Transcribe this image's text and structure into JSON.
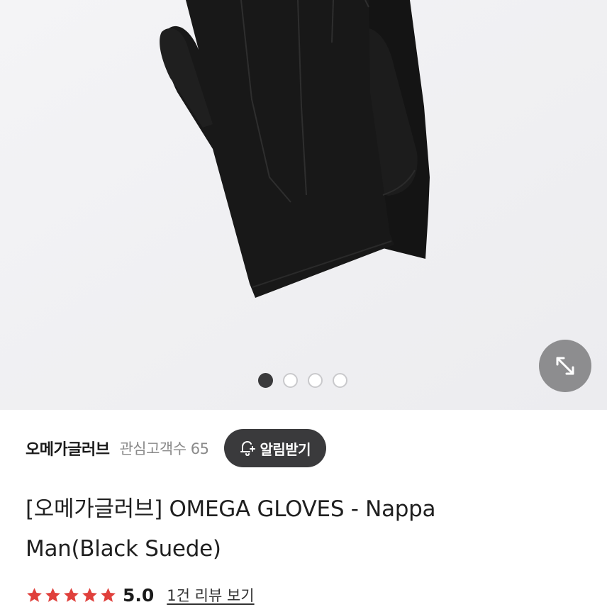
{
  "product_image": {
    "dots": [
      {
        "active": true
      },
      {
        "active": false
      },
      {
        "active": false
      },
      {
        "active": false
      }
    ],
    "zoom_icon": "expand-arrows-icon"
  },
  "store": {
    "name": "오메가글러브",
    "followers": "관심고객수 65",
    "notify_label": "알림받기",
    "notify_icon": "bell-plus-icon"
  },
  "product": {
    "title": "[오메가글러브] OMEGA GLOVES - Nappa Man(Black Suede)"
  },
  "rating": {
    "stars": 5,
    "value": "5.0",
    "review_link": "1건 리뷰 보기",
    "star_color": "#e0403c"
  }
}
